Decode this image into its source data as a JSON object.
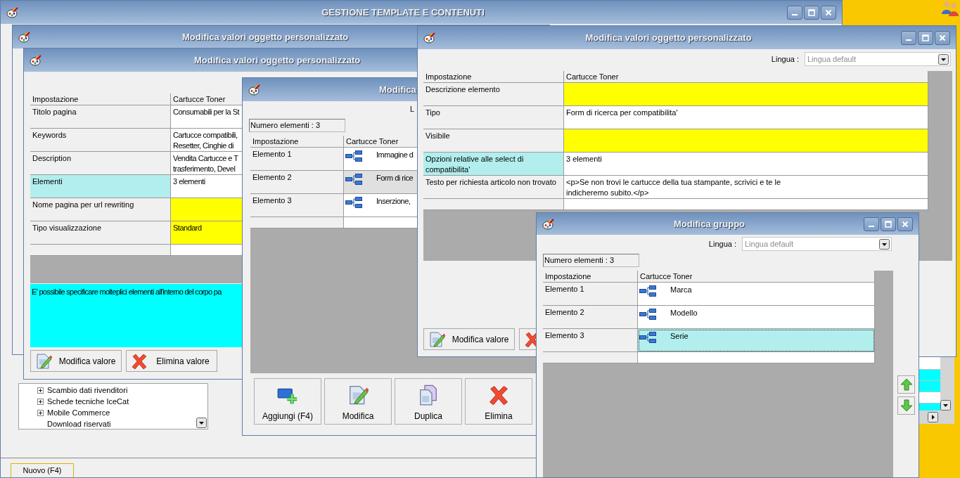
{
  "main_window": {
    "title": "GESTIONE TEMPLATE E CONTENUTI",
    "tree": [
      {
        "label": "Scambio dati rivenditori",
        "expandable": true
      },
      {
        "label": "Schede tecniche IceCat",
        "expandable": true
      },
      {
        "label": "Mobile Commerce",
        "expandable": true
      },
      {
        "label": "Download riservati",
        "expandable": false
      }
    ],
    "new_button": "Nuovo (F4)"
  },
  "back_window": {
    "title": "Modifica valori oggetto personalizzato"
  },
  "template_window": {
    "title": "Modifica valori oggetto personalizzato",
    "columns": [
      "Impostazione",
      "Cartucce Toner"
    ],
    "rows": [
      {
        "label": "Titolo pagina",
        "value": "Consumabili per la St",
        "selected": false,
        "required": false
      },
      {
        "label": "Keywords",
        "value": "Cartucce compatibili,\nResetter, Cinghie di",
        "selected": false,
        "required": false
      },
      {
        "label": "Description",
        "value": "Vendita Cartucce e T\ntrasferimento, Devel",
        "selected": false,
        "required": false
      },
      {
        "label": "Elementi",
        "value": "3 elementi",
        "selected": true,
        "required": false
      },
      {
        "label": "Nome pagina per url rewriting",
        "selected": false,
        "required": true
      },
      {
        "label": "Tipo visualizzazione",
        "value": "Standard",
        "selected": false,
        "required": true
      }
    ],
    "description": "E' possibile specificare molteplici elementi all'interno del corpo pa",
    "buttons": [
      {
        "label": "Modifica valore",
        "kind": "edit"
      },
      {
        "label": "Elimina valore",
        "kind": "delete"
      }
    ]
  },
  "elements_window": {
    "title": "Modifica",
    "language_label": "L",
    "count": "Numero elementi : 3",
    "columns": [
      "Impostazione",
      "Cartucce Toner"
    ],
    "rows": [
      {
        "label": "Elemento 1",
        "value": "Immagine d",
        "selected": false
      },
      {
        "label": "Elemento 2",
        "value": "Form di rice",
        "selected": true
      },
      {
        "label": "Elemento 3",
        "value": "Inserzione,",
        "selected": false
      }
    ],
    "buttons": [
      {
        "label": "Aggiungi (F4)",
        "kind": "add"
      },
      {
        "label": "Modifica",
        "kind": "edit"
      },
      {
        "label": "Duplica",
        "kind": "duplicate"
      },
      {
        "label": "Elimina",
        "kind": "delete"
      }
    ]
  },
  "element_window": {
    "title": "Modifica valori oggetto personalizzato",
    "language_label": "Lingua :",
    "language": "Lingua default",
    "columns": [
      "Impostazione",
      "Cartucce Toner"
    ],
    "rows": [
      {
        "label": "Descrizione elemento",
        "selected": false,
        "required": true
      },
      {
        "label": "Tipo",
        "value": "Form di ricerca per compatibilita'",
        "selected": false,
        "required": false
      },
      {
        "label": "Visibile",
        "selected": false,
        "required": true
      },
      {
        "label": "Opzioni relative alle select di\ncompatibilita'",
        "value": "3 elementi",
        "selected": true,
        "required": false
      },
      {
        "label": "Testo per richiesta articolo non trovato",
        "value": "<p>Se non trovi le cartucce della tua stampante, scrivici e te le\nindicheremo subito.</p>",
        "selected": false,
        "required": false
      }
    ],
    "buttons": [
      {
        "label": "Modifica valore",
        "kind": "edit"
      },
      {
        "kind": "delete"
      }
    ]
  },
  "group_window": {
    "title": "Modifica gruppo",
    "language_label": "Lingua :",
    "language": "Lingua default",
    "count": "Numero elementi : 3",
    "columns": [
      "Impostazione",
      "Cartucce Toner"
    ],
    "rows": [
      {
        "label": "Elemento 1",
        "value": "Marca",
        "selected": false
      },
      {
        "label": "Elemento 2",
        "value": "Modello",
        "selected": false
      },
      {
        "label": "Elemento 3",
        "value": "Serie",
        "selected": true
      }
    ]
  }
}
